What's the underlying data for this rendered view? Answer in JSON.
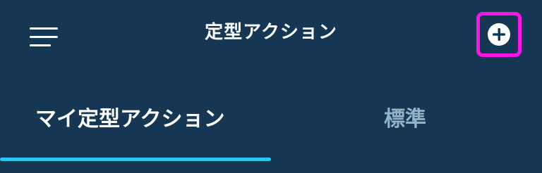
{
  "header": {
    "title": "定型アクション",
    "menu_icon": "hamburger-menu-icon",
    "add_icon": "plus-circle-icon"
  },
  "tabs": [
    {
      "label": "マイ定型アクション",
      "selected": true
    },
    {
      "label": "標準",
      "selected": false
    }
  ],
  "colors": {
    "background": "#163753",
    "title_text": "#ffffff",
    "inactive_tab_text": "#8fb4c8",
    "active_indicator": "#2bc4f5",
    "highlight_box": "#ff14e6"
  }
}
